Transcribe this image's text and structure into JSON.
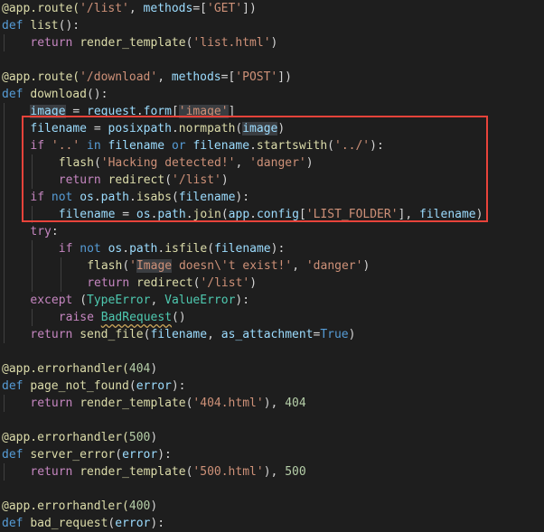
{
  "editor": {
    "language": "python",
    "theme_colors": {
      "background": "#1e1e1e",
      "keyword": "#569cd6",
      "control": "#c586c0",
      "function": "#dcdcaa",
      "string": "#ce9178",
      "variable": "#9cdcfe",
      "parameter": "#9cdcfe",
      "number": "#b5cea8",
      "class": "#4ec9b0",
      "decorator": "#dcdcaa",
      "plain": "#d4d4d4",
      "highlight_box": "#e8433a"
    },
    "lines": [
      {
        "indent": 0,
        "tokens": [
          [
            "@app.route(",
            "decorator"
          ],
          [
            "'/list'",
            "string"
          ],
          [
            ", ",
            "plain"
          ],
          [
            "methods",
            "parameter"
          ],
          [
            "=[",
            "plain"
          ],
          [
            "'GET'",
            "string"
          ],
          [
            "])",
            "plain"
          ]
        ]
      },
      {
        "indent": 0,
        "tokens": [
          [
            "def ",
            "keyword"
          ],
          [
            "list",
            "function"
          ],
          [
            "():",
            "plain"
          ]
        ]
      },
      {
        "indent": 1,
        "tokens": [
          [
            "return ",
            "control"
          ],
          [
            "render_template",
            "function"
          ],
          [
            "(",
            "plain"
          ],
          [
            "'list.html'",
            "string"
          ],
          [
            ")",
            "plain"
          ]
        ]
      },
      {
        "indent": 0,
        "tokens": []
      },
      {
        "indent": 0,
        "tokens": [
          [
            "@app.route(",
            "decorator"
          ],
          [
            "'/download'",
            "string"
          ],
          [
            ", ",
            "plain"
          ],
          [
            "methods",
            "parameter"
          ],
          [
            "=[",
            "plain"
          ],
          [
            "'POST'",
            "string"
          ],
          [
            "])",
            "plain"
          ]
        ]
      },
      {
        "indent": 0,
        "tokens": [
          [
            "def ",
            "keyword"
          ],
          [
            "download",
            "function"
          ],
          [
            "():",
            "plain"
          ]
        ]
      },
      {
        "indent": 1,
        "tokens": [
          [
            "image",
            "variable",
            "sel"
          ],
          [
            " = ",
            "plain"
          ],
          [
            "request",
            "variable"
          ],
          [
            ".",
            "plain"
          ],
          [
            "form",
            "variable"
          ],
          [
            "[",
            "plain"
          ],
          [
            "'image'",
            "string",
            "sel"
          ],
          [
            "]",
            "plain"
          ]
        ]
      },
      {
        "indent": 1,
        "tokens": [
          [
            "filename",
            "variable"
          ],
          [
            " = ",
            "plain"
          ],
          [
            "posixpath",
            "variable"
          ],
          [
            ".",
            "plain"
          ],
          [
            "normpath",
            "function"
          ],
          [
            "(",
            "plain"
          ],
          [
            "image",
            "variable",
            "sel"
          ],
          [
            ")",
            "plain"
          ]
        ]
      },
      {
        "indent": 1,
        "tokens": [
          [
            "if ",
            "control"
          ],
          [
            "'..'",
            "string"
          ],
          [
            " in ",
            "keyword"
          ],
          [
            "filename",
            "variable"
          ],
          [
            " or ",
            "keyword"
          ],
          [
            "filename",
            "variable"
          ],
          [
            ".",
            "plain"
          ],
          [
            "startswith",
            "function"
          ],
          [
            "(",
            "plain"
          ],
          [
            "'../'",
            "string"
          ],
          [
            "):",
            "plain"
          ]
        ]
      },
      {
        "indent": 2,
        "tokens": [
          [
            "flash",
            "function"
          ],
          [
            "(",
            "plain"
          ],
          [
            "'Hacking detected!'",
            "string"
          ],
          [
            ", ",
            "plain"
          ],
          [
            "'danger'",
            "string"
          ],
          [
            ")",
            "plain"
          ]
        ]
      },
      {
        "indent": 2,
        "tokens": [
          [
            "return ",
            "control"
          ],
          [
            "redirect",
            "function"
          ],
          [
            "(",
            "plain"
          ],
          [
            "'/list'",
            "string"
          ],
          [
            ")",
            "plain"
          ]
        ]
      },
      {
        "indent": 1,
        "tokens": [
          [
            "if ",
            "control"
          ],
          [
            "not ",
            "keyword"
          ],
          [
            "os",
            "variable"
          ],
          [
            ".",
            "plain"
          ],
          [
            "path",
            "variable"
          ],
          [
            ".",
            "plain"
          ],
          [
            "isabs",
            "function"
          ],
          [
            "(",
            "plain"
          ],
          [
            "filename",
            "variable"
          ],
          [
            "):",
            "plain"
          ]
        ]
      },
      {
        "indent": 2,
        "tokens": [
          [
            "filename",
            "variable"
          ],
          [
            " = ",
            "plain"
          ],
          [
            "os",
            "variable"
          ],
          [
            ".",
            "plain"
          ],
          [
            "path",
            "variable"
          ],
          [
            ".",
            "plain"
          ],
          [
            "join",
            "function"
          ],
          [
            "(",
            "plain"
          ],
          [
            "app",
            "variable"
          ],
          [
            ".",
            "plain"
          ],
          [
            "config",
            "variable"
          ],
          [
            "[",
            "plain"
          ],
          [
            "'LIST_FOLDER'",
            "string"
          ],
          [
            "], ",
            "plain"
          ],
          [
            "filename",
            "variable"
          ],
          [
            ")",
            "plain"
          ]
        ]
      },
      {
        "indent": 1,
        "tokens": [
          [
            "try",
            "control"
          ],
          [
            ":",
            "plain"
          ]
        ]
      },
      {
        "indent": 2,
        "tokens": [
          [
            "if ",
            "control"
          ],
          [
            "not ",
            "keyword"
          ],
          [
            "os",
            "variable"
          ],
          [
            ".",
            "plain"
          ],
          [
            "path",
            "variable"
          ],
          [
            ".",
            "plain"
          ],
          [
            "isfile",
            "function"
          ],
          [
            "(",
            "plain"
          ],
          [
            "filename",
            "variable"
          ],
          [
            "):",
            "plain"
          ]
        ]
      },
      {
        "indent": 3,
        "tokens": [
          [
            "flash",
            "function"
          ],
          [
            "(",
            "plain"
          ],
          [
            "'",
            "string"
          ],
          [
            "Image",
            "string",
            "sel"
          ],
          [
            " doesn\\'t exist!'",
            "string"
          ],
          [
            ", ",
            "plain"
          ],
          [
            "'danger'",
            "string"
          ],
          [
            ")",
            "plain"
          ]
        ]
      },
      {
        "indent": 3,
        "tokens": [
          [
            "return ",
            "control"
          ],
          [
            "redirect",
            "function"
          ],
          [
            "(",
            "plain"
          ],
          [
            "'/list'",
            "string"
          ],
          [
            ")",
            "plain"
          ]
        ]
      },
      {
        "indent": 1,
        "tokens": [
          [
            "except ",
            "control"
          ],
          [
            "(",
            "plain"
          ],
          [
            "TypeError",
            "class"
          ],
          [
            ", ",
            "plain"
          ],
          [
            "ValueError",
            "class"
          ],
          [
            "):",
            "plain"
          ]
        ]
      },
      {
        "indent": 2,
        "tokens": [
          [
            "raise ",
            "control"
          ],
          [
            "BadRequest",
            "class",
            "squiggle"
          ],
          [
            "()",
            "plain"
          ]
        ]
      },
      {
        "indent": 1,
        "tokens": [
          [
            "return ",
            "control"
          ],
          [
            "send_file",
            "function"
          ],
          [
            "(",
            "plain"
          ],
          [
            "filename",
            "variable"
          ],
          [
            ", ",
            "plain"
          ],
          [
            "as_attachment",
            "parameter"
          ],
          [
            "=",
            "plain"
          ],
          [
            "True",
            "keyword"
          ],
          [
            ")",
            "plain"
          ]
        ]
      },
      {
        "indent": 0,
        "tokens": []
      },
      {
        "indent": 0,
        "tokens": [
          [
            "@app.errorhandler(",
            "decorator"
          ],
          [
            "404",
            "number"
          ],
          [
            ")",
            "plain"
          ]
        ]
      },
      {
        "indent": 0,
        "tokens": [
          [
            "def ",
            "keyword"
          ],
          [
            "page_not_found",
            "function"
          ],
          [
            "(",
            "plain"
          ],
          [
            "error",
            "parameter"
          ],
          [
            "):",
            "plain"
          ]
        ]
      },
      {
        "indent": 1,
        "tokens": [
          [
            "return ",
            "control"
          ],
          [
            "render_template",
            "function"
          ],
          [
            "(",
            "plain"
          ],
          [
            "'404.html'",
            "string"
          ],
          [
            "), ",
            "plain"
          ],
          [
            "404",
            "number"
          ]
        ]
      },
      {
        "indent": 0,
        "tokens": []
      },
      {
        "indent": 0,
        "tokens": [
          [
            "@app.errorhandler(",
            "decorator"
          ],
          [
            "500",
            "number"
          ],
          [
            ")",
            "plain"
          ]
        ]
      },
      {
        "indent": 0,
        "tokens": [
          [
            "def ",
            "keyword"
          ],
          [
            "server_error",
            "function"
          ],
          [
            "(",
            "plain"
          ],
          [
            "error",
            "parameter"
          ],
          [
            "):",
            "plain"
          ]
        ]
      },
      {
        "indent": 1,
        "tokens": [
          [
            "return ",
            "control"
          ],
          [
            "render_template",
            "function"
          ],
          [
            "(",
            "plain"
          ],
          [
            "'500.html'",
            "string"
          ],
          [
            "), ",
            "plain"
          ],
          [
            "500",
            "number"
          ]
        ]
      },
      {
        "indent": 0,
        "tokens": []
      },
      {
        "indent": 0,
        "tokens": [
          [
            "@app.errorhandler(",
            "decorator"
          ],
          [
            "400",
            "number"
          ],
          [
            ")",
            "plain"
          ]
        ]
      },
      {
        "indent": 0,
        "tokens": [
          [
            "def ",
            "keyword"
          ],
          [
            "bad_request",
            "function"
          ],
          [
            "(",
            "plain"
          ],
          [
            "error",
            "parameter"
          ],
          [
            "):",
            "plain"
          ]
        ]
      }
    ]
  }
}
